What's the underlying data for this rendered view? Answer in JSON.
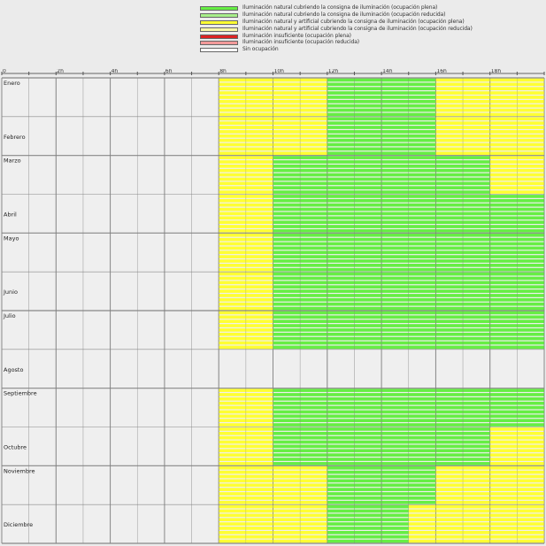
{
  "chart_data": {
    "type": "heatmap",
    "title": "",
    "xlabel": "",
    "ylabel": "",
    "x_ticks": [
      "0",
      "2h",
      "4h",
      "6h",
      "8h",
      "10h",
      "12h",
      "14h",
      "16h",
      "18h"
    ],
    "x_range_hours": [
      0,
      20
    ],
    "months": [
      "Enero",
      "Febrero",
      "Marzo",
      "Abril",
      "Mayo",
      "Junio",
      "Julio",
      "Agosto",
      "Septiembre",
      "Octubre",
      "Noviembre",
      "Diciembre"
    ],
    "legend": [
      {
        "label": "Iluminación natural cubriendo la consigna de iluminación (ocupación plena)",
        "color": "#66ee44"
      },
      {
        "label": "Iluminación natural cubriendo la consigna de iluminación (ocupación reducida)",
        "color": "#a8f08a"
      },
      {
        "label": "Iluminación natural y artificial cubriendo la consigna de iluminación (ocupación plena)",
        "color": "#ffff33"
      },
      {
        "label": "Iluminación natural y artificial cubriendo la consigna de iluminación (ocupación reducida)",
        "color": "#fbf8a8"
      },
      {
        "label": "Iluminación insuficiente (ocupación plena)",
        "color": "#dd2222"
      },
      {
        "label": "Iluminación insuficiente (ocupación reducida)",
        "color": "#f29a9a"
      },
      {
        "label": "Sin ocupación",
        "color": "#ffffff"
      }
    ],
    "occupancy_hours": [
      8,
      20
    ],
    "monthly_patterns": [
      {
        "month": "Enero",
        "yellow_before": [
          8,
          12
        ],
        "green": [
          12,
          16
        ],
        "yellow_after": [
          16,
          20
        ]
      },
      {
        "month": "Febrero",
        "yellow_before": [
          8,
          12
        ],
        "green": [
          12,
          16
        ],
        "yellow_after": [
          16,
          20
        ]
      },
      {
        "month": "Marzo",
        "yellow_before": [
          8,
          10
        ],
        "green": [
          10,
          18
        ],
        "yellow_after": [
          18,
          20
        ]
      },
      {
        "month": "Abril",
        "yellow_before": [
          8,
          10
        ],
        "green": [
          10,
          20
        ],
        "yellow_after": []
      },
      {
        "month": "Mayo",
        "yellow_before": [
          8,
          10
        ],
        "green": [
          10,
          20
        ],
        "yellow_after": []
      },
      {
        "month": "Junio",
        "yellow_before": [
          8,
          10
        ],
        "green": [
          10,
          20
        ],
        "yellow_after": []
      },
      {
        "month": "Julio",
        "yellow_before": [
          8,
          10
        ],
        "green": [
          10,
          20
        ],
        "yellow_after": []
      },
      {
        "month": "Agosto",
        "yellow_before": [],
        "green": [],
        "yellow_after": [],
        "no_occupancy": true
      },
      {
        "month": "Septiembre",
        "yellow_before": [
          8,
          10
        ],
        "green": [
          10,
          20
        ],
        "yellow_after": []
      },
      {
        "month": "Octubre",
        "yellow_before": [
          8,
          10
        ],
        "green": [
          10,
          18
        ],
        "yellow_after": [
          18,
          20
        ]
      },
      {
        "month": "Noviembre",
        "yellow_before": [
          8,
          12
        ],
        "green": [
          12,
          16
        ],
        "yellow_after": [
          16,
          20
        ]
      },
      {
        "month": "Diciembre",
        "yellow_before": [
          8,
          12
        ],
        "green": [
          12,
          15
        ],
        "yellow_after": [
          15,
          20
        ]
      }
    ],
    "grid": true
  }
}
